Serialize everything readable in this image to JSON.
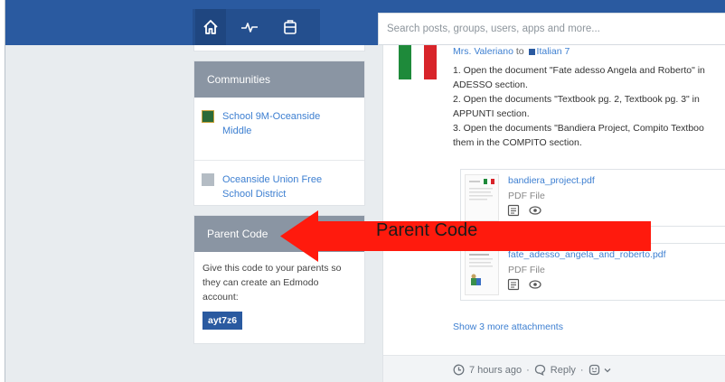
{
  "search": {
    "placeholder": "Search posts, groups, users, apps and more..."
  },
  "nav": {
    "icons": [
      "home-icon",
      "pulse-icon",
      "backpack-icon"
    ]
  },
  "communities": {
    "title": "Communities",
    "items": [
      {
        "label_line1": "School 9M-Oceanside",
        "label_line2": "Middle",
        "icon": "school-icon"
      },
      {
        "label_line1": "Oceanside Union Free",
        "label_line2": "School District",
        "icon": "district-icon"
      }
    ]
  },
  "parent_code": {
    "title": "Parent Code",
    "text_line1": "Give this code to your parents so",
    "text_line2": "they can create an Edmodo",
    "text_line3": "account:",
    "code": "ayt7z6"
  },
  "post": {
    "author": "Mrs. Valeriano",
    "to": "to",
    "group": "Italian 7",
    "lines": [
      "1. Open the document \"Fate adesso Angela and Roberto\" in",
      "ADESSO section.",
      "2. Open the documents \"Textbook pg. 2, Textbook pg. 3\" in",
      "APPUNTI section.",
      "3. Open the documents \"Bandiera Project, Compito Textboo",
      "them in the COMPITO section."
    ],
    "attachments": [
      {
        "name": "bandiera_project.pdf",
        "type": "PDF File"
      },
      {
        "name": "fate_adesso_angela_and_roberto.pdf",
        "type": "PDF File"
      }
    ],
    "show_more": "Show 3 more attachments",
    "time": "7 hours ago",
    "reply": "Reply"
  },
  "annotation": {
    "label": "Parent Code",
    "color": "#ff1a0d"
  },
  "colors": {
    "brand_blue": "#2a5aa0",
    "link": "#3d7fd1",
    "card_header": "#8a95a3"
  }
}
